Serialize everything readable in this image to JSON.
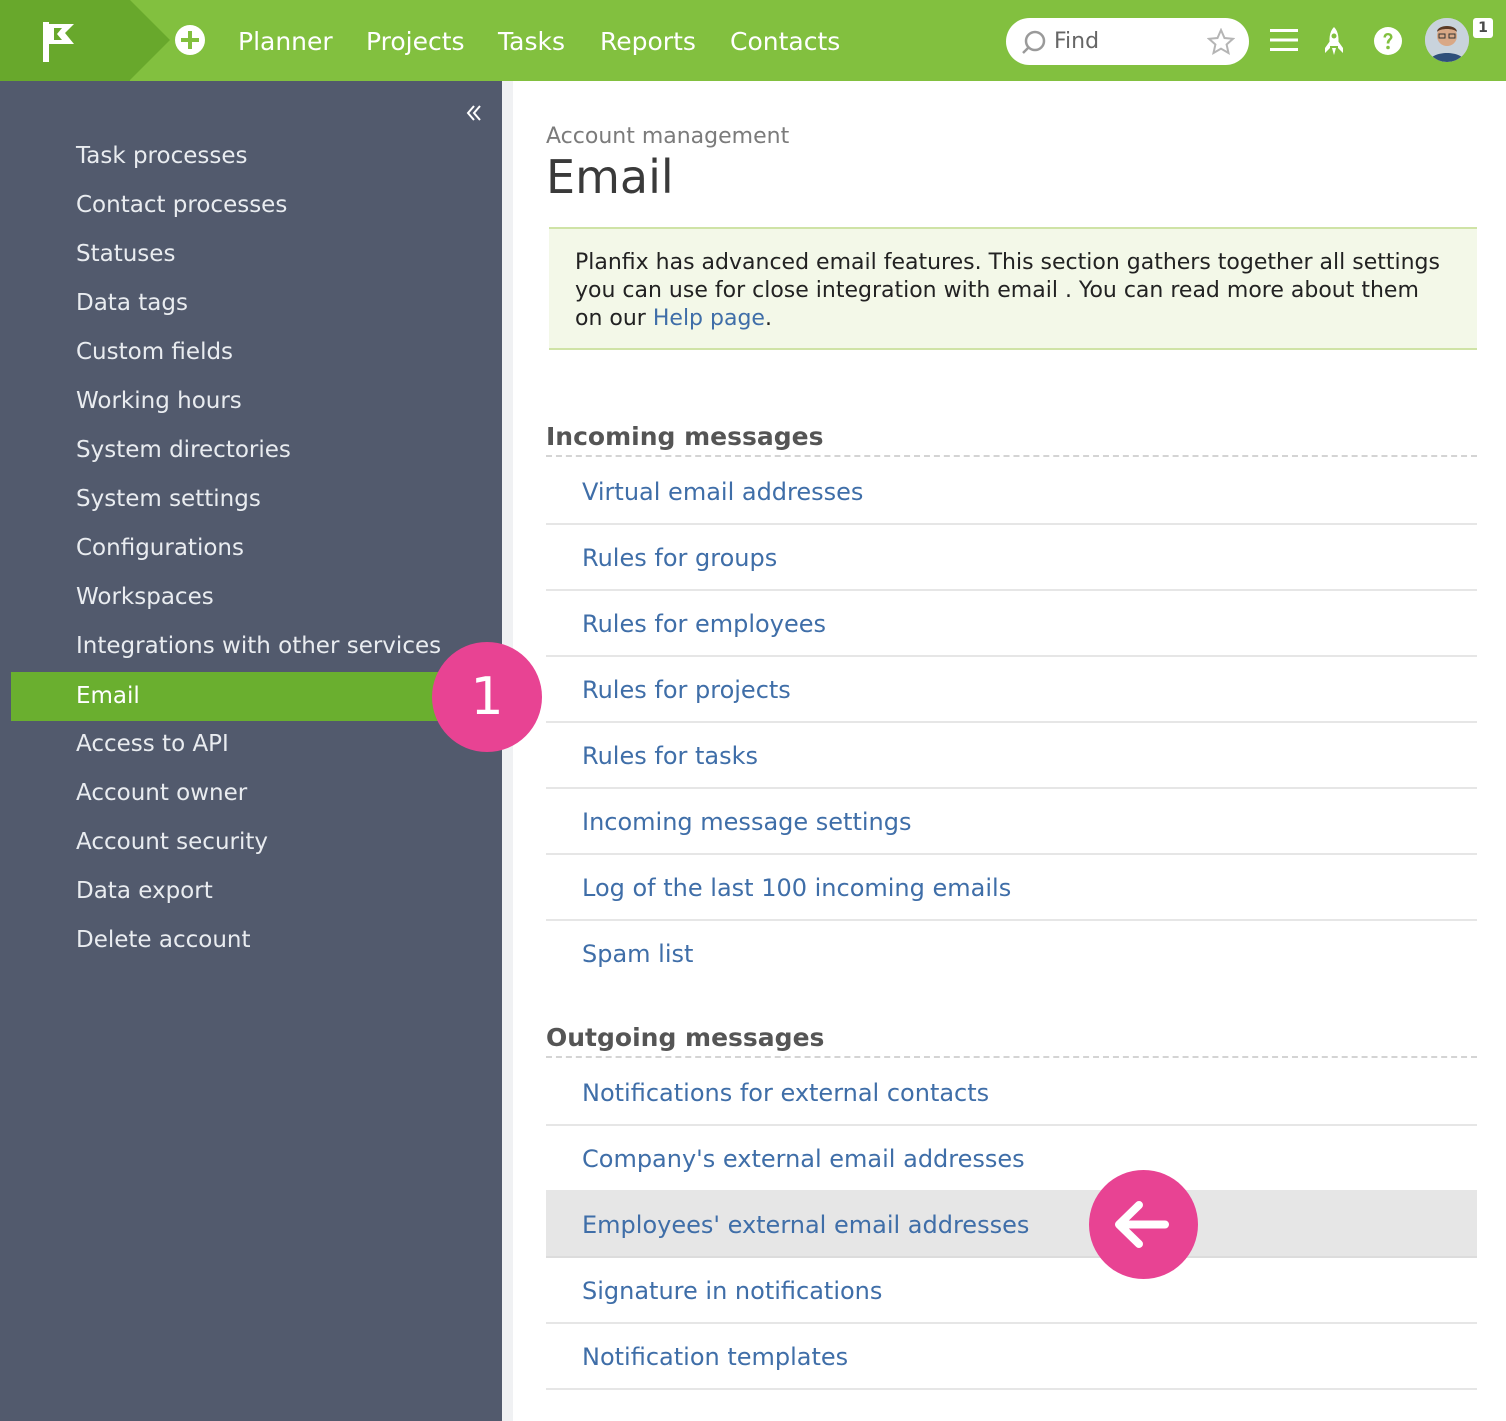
{
  "topbar": {
    "nav": [
      "Planner",
      "Projects",
      "Tasks",
      "Reports",
      "Contacts"
    ],
    "search_placeholder": "Find",
    "notification_count": "1",
    "colors": {
      "bar": "#82c03f",
      "logo": "#68a82c"
    },
    "icons": [
      "flag-logo-icon",
      "plus-circle-icon",
      "search-icon",
      "star-icon",
      "menu-icon",
      "rocket-icon",
      "help-icon"
    ]
  },
  "sidebar": {
    "items": [
      "Task processes",
      "Contact processes",
      "Statuses",
      "Data tags",
      "Custom fields",
      "Working hours",
      "System directories",
      "System settings",
      "Configurations",
      "Workspaces",
      "Integrations with other services",
      "Email",
      "Access to API",
      "Account owner",
      "Account security",
      "Data export",
      "Delete account"
    ],
    "active_item": "Email",
    "colors": {
      "background": "#525a6d",
      "active": "#6aaf2f"
    }
  },
  "callouts": {
    "step": "1",
    "arrow_icon": "arrow-left-icon",
    "color": "#e84393"
  },
  "main": {
    "breadcrumb": "Account management",
    "title": "Email",
    "info": {
      "text": "Planfix has advanced email features. This section gathers together all settings you can use for close integration with email . You can read more about them on our",
      "link": "Help page",
      "end": "."
    },
    "incoming": {
      "title": "Incoming messages",
      "links": [
        "Virtual email addresses",
        "Rules for groups",
        "Rules for employees",
        "Rules for projects",
        "Rules for tasks",
        "Incoming message settings",
        "Log of the last 100 incoming emails",
        "Spam list"
      ]
    },
    "outgoing": {
      "title": "Outgoing messages",
      "links": [
        "Notifications for external contacts",
        "Company's external email addresses",
        "Employees' external email addresses",
        "Signature in notifications",
        "Notification templates"
      ],
      "highlighted": "Employees' external email addresses"
    },
    "link_color": "#3f6ea8"
  }
}
